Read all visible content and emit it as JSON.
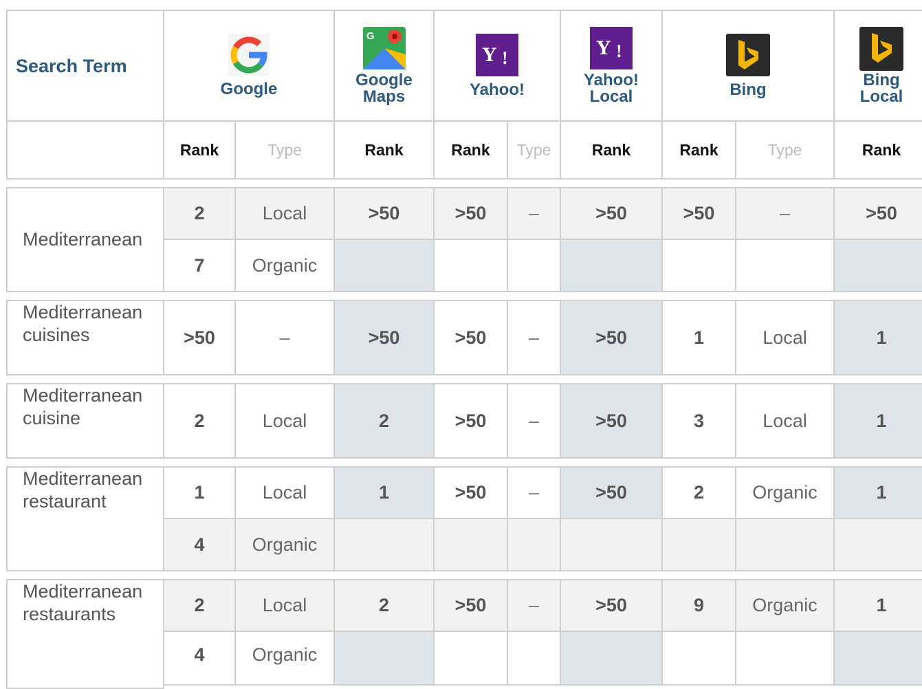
{
  "header": {
    "search_term": "Search Term",
    "engines": {
      "google": "Google",
      "google_maps_l1": "Google",
      "google_maps_l2": "Maps",
      "yahoo": "Yahoo!",
      "yahoo_local_l1": "Yahoo!",
      "yahoo_local_l2": "Local",
      "bing": "Bing",
      "bing_local_l1": "Bing",
      "bing_local_l2": "Local"
    },
    "icons": {
      "google": "google-logo-icon",
      "google_maps": "google-maps-icon",
      "yahoo": "yahoo-icon",
      "yahoo_local": "yahoo-local-icon",
      "bing": "bing-icon",
      "bing_local": "bing-local-icon"
    }
  },
  "subheader": {
    "rank": "Rank",
    "type": "Type"
  },
  "rows": [
    {
      "term": "Mediterranean",
      "google": [
        {
          "rank": "2",
          "type": "Local"
        },
        {
          "rank": "7",
          "type": "Organic"
        }
      ],
      "google_maps": ">50",
      "yahoo": {
        "rank": ">50",
        "type": "–"
      },
      "yahoo_local": ">50",
      "bing": {
        "rank": ">50",
        "type": "–"
      },
      "bing_local": ">50"
    },
    {
      "term_l1": "Mediterranean",
      "term_l2": "cuisines",
      "google": {
        "rank": ">50",
        "type": "–"
      },
      "google_maps": ">50",
      "yahoo": {
        "rank": ">50",
        "type": "–"
      },
      "yahoo_local": ">50",
      "bing": {
        "rank": "1",
        "type": "Local"
      },
      "bing_local": "1"
    },
    {
      "term_l1": "Mediterranean",
      "term_l2": "cuisine",
      "google": {
        "rank": "2",
        "type": "Local"
      },
      "google_maps": "2",
      "yahoo": {
        "rank": ">50",
        "type": "–"
      },
      "yahoo_local": ">50",
      "bing": {
        "rank": "3",
        "type": "Local"
      },
      "bing_local": "1"
    },
    {
      "term_l1": "Mediterranean",
      "term_l2": "restaurant",
      "google": [
        {
          "rank": "1",
          "type": "Local"
        },
        {
          "rank": "4",
          "type": "Organic"
        }
      ],
      "google_maps": "1",
      "yahoo": {
        "rank": ">50",
        "type": "–"
      },
      "yahoo_local": ">50",
      "bing": {
        "rank": "2",
        "type": "Organic"
      },
      "bing_local": "1"
    },
    {
      "term_l1": "Mediterranean",
      "term_l2": "restaurants",
      "google": [
        {
          "rank": "2",
          "type": "Local"
        },
        {
          "rank": "4",
          "type": "Organic"
        }
      ],
      "google_maps": "2",
      "yahoo": {
        "rank": ">50",
        "type": "–"
      },
      "yahoo_local": ">50",
      "bing": {
        "rank": "9",
        "type": "Organic"
      },
      "bing_local": "1"
    }
  ],
  "colors": {
    "header_text": "#2c5a80",
    "border": "#cfcfcf",
    "gray_cell": "#f2f2f2",
    "blue_cell": "#dfe4ea",
    "yahoo_purple": "#5f1f8f",
    "bing_dark": "#2b2b2b",
    "bing_orange": "#f4b400"
  }
}
